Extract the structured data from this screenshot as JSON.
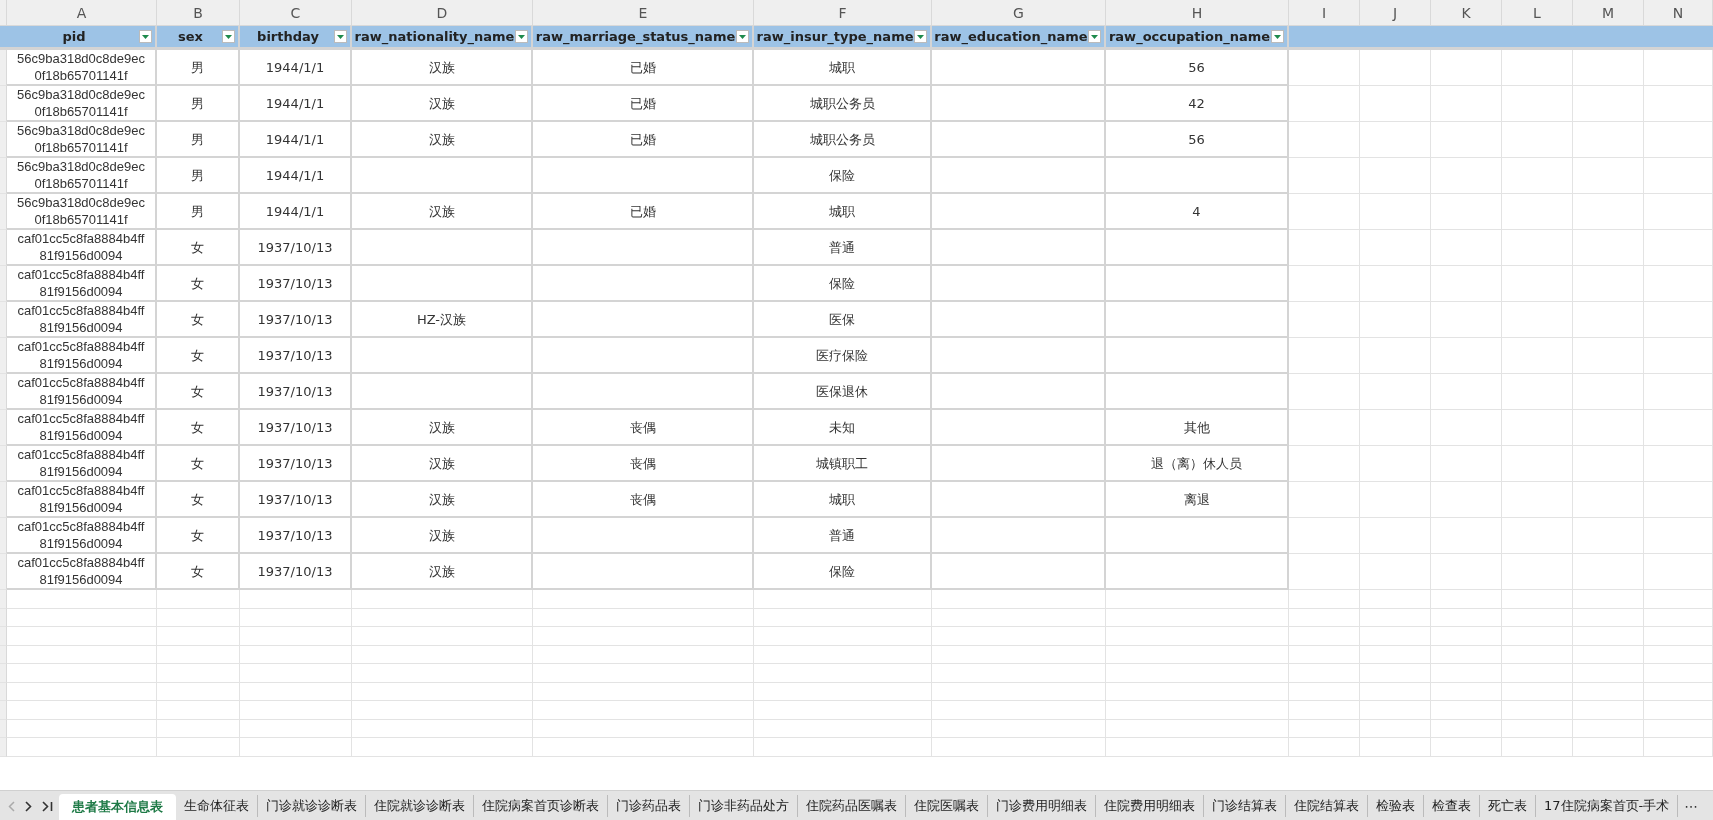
{
  "column_letters": [
    "A",
    "B",
    "C",
    "D",
    "E",
    "F",
    "G",
    "H",
    "I",
    "J",
    "K",
    "L",
    "M",
    "N"
  ],
  "table": {
    "columns": [
      {
        "label": "pid",
        "filter": true
      },
      {
        "label": "sex",
        "filter": true
      },
      {
        "label": "birthday",
        "filter": true
      },
      {
        "label": "raw_nationality_name",
        "filter": true
      },
      {
        "label": "raw_marriage_status_name",
        "filter": true
      },
      {
        "label": "raw_insur_type_name",
        "filter": true
      },
      {
        "label": "raw_education_name",
        "filter": true
      },
      {
        "label": "raw_occupation_name",
        "filter": true
      }
    ],
    "rows": [
      [
        "56c9ba318d0c8de9ec0f18b65701141f",
        "男",
        "1944/1/1",
        "汉族",
        "已婚",
        "城职",
        null,
        "56"
      ],
      [
        "56c9ba318d0c8de9ec0f18b65701141f",
        "男",
        "1944/1/1",
        "汉族",
        "已婚",
        "城职公务员",
        null,
        "42"
      ],
      [
        "56c9ba318d0c8de9ec0f18b65701141f",
        "男",
        "1944/1/1",
        "汉族",
        "已婚",
        "城职公务员",
        null,
        "56"
      ],
      [
        "56c9ba318d0c8de9ec0f18b65701141f",
        "男",
        "1944/1/1",
        null,
        null,
        "保险",
        null,
        null
      ],
      [
        "56c9ba318d0c8de9ec0f18b65701141f",
        "男",
        "1944/1/1",
        "汉族",
        "已婚",
        "城职",
        null,
        "4"
      ],
      [
        "caf01cc5c8fa8884b4ff81f9156d0094",
        "女",
        "1937/10/13",
        null,
        null,
        "普通",
        null,
        null
      ],
      [
        "caf01cc5c8fa8884b4ff81f9156d0094",
        "女",
        "1937/10/13",
        null,
        null,
        "保险",
        null,
        null
      ],
      [
        "caf01cc5c8fa8884b4ff81f9156d0094",
        "女",
        "1937/10/13",
        "HZ-汉族",
        null,
        "医保",
        null,
        null
      ],
      [
        "caf01cc5c8fa8884b4ff81f9156d0094",
        "女",
        "1937/10/13",
        null,
        null,
        "医疗保险",
        null,
        null
      ],
      [
        "caf01cc5c8fa8884b4ff81f9156d0094",
        "女",
        "1937/10/13",
        null,
        null,
        "医保退休",
        null,
        null
      ],
      [
        "caf01cc5c8fa8884b4ff81f9156d0094",
        "女",
        "1937/10/13",
        "汉族",
        "丧偶",
        "未知",
        null,
        "其他"
      ],
      [
        "caf01cc5c8fa8884b4ff81f9156d0094",
        "女",
        "1937/10/13",
        "汉族",
        "丧偶",
        "城镇职工",
        null,
        "退（离）休人员"
      ],
      [
        "caf01cc5c8fa8884b4ff81f9156d0094",
        "女",
        "1937/10/13",
        "汉族",
        "丧偶",
        "城职",
        null,
        "离退"
      ],
      [
        "caf01cc5c8fa8884b4ff81f9156d0094",
        "女",
        "1937/10/13",
        "汉族",
        null,
        "普通",
        null,
        null
      ],
      [
        "caf01cc5c8fa8884b4ff81f9156d0094",
        "女",
        "1937/10/13",
        "汉族",
        null,
        "保险",
        null,
        null
      ]
    ]
  },
  "sheet_tabs": [
    {
      "label": "患者基本信息表",
      "selected": true
    },
    {
      "label": "生命体征表",
      "selected": false
    },
    {
      "label": "门诊就诊诊断表",
      "selected": false
    },
    {
      "label": "住院就诊诊断表",
      "selected": false
    },
    {
      "label": "住院病案首页诊断表",
      "selected": false
    },
    {
      "label": "门诊药品表",
      "selected": false
    },
    {
      "label": "门诊非药品处方",
      "selected": false
    },
    {
      "label": "住院药品医嘱表",
      "selected": false
    },
    {
      "label": "住院医嘱表",
      "selected": false
    },
    {
      "label": "门诊费用明细表",
      "selected": false
    },
    {
      "label": "住院费用明细表",
      "selected": false
    },
    {
      "label": "门诊结算表",
      "selected": false
    },
    {
      "label": "住院结算表",
      "selected": false
    },
    {
      "label": "检验表",
      "selected": false
    },
    {
      "label": "检查表",
      "selected": false
    },
    {
      "label": "死亡表",
      "selected": false
    },
    {
      "label": "17住院病案首页-手术",
      "selected": false
    }
  ],
  "more_tabs": "⋯"
}
